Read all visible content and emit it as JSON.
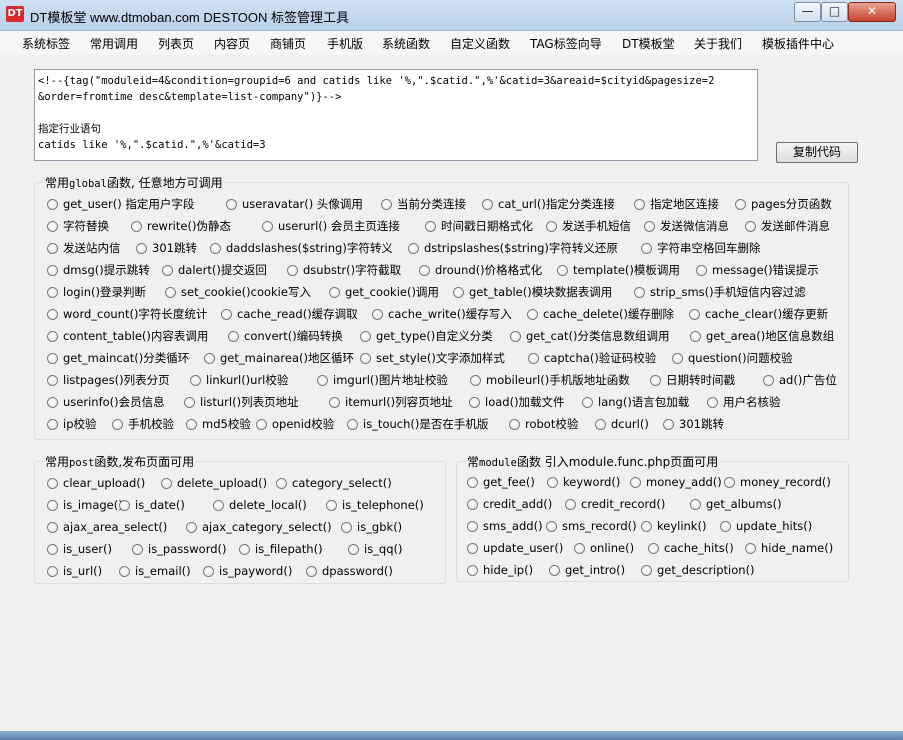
{
  "window": {
    "icon_text": "DT",
    "title": "DT模板堂 www.dtmoban.com DESTOON 标签管理工具",
    "minimize": "—",
    "maximize": "□",
    "close": "✕"
  },
  "menu": [
    "系统标签",
    "常用调用",
    "列表页",
    "内容页",
    "商铺页",
    "手机版",
    "系统函数",
    "自定义函数",
    "TAG标签向导",
    "DT模板堂",
    "关于我们",
    "模板插件中心"
  ],
  "code": {
    "lines": [
      "<!--{tag(\"moduleid=4&condition=groupid=6 and catids like '%,\".$catid.\",%'&catid=3&areaid=$cityid&pagesize=2",
      "&order=fromtime desc&template=list-company\")}-->",
      "",
      "指定行业语句",
      "catids like '%,\".$catid.\",%'&catid=3"
    ]
  },
  "copy_button": "复制代码",
  "global_group": {
    "title_prefix": "常用",
    "title_mono": "global",
    "title_suffix": "函数, 任意地方可调用",
    "rows": [
      [
        "get_user() 指定用户字段",
        "useravatar() 头像调用",
        "当前分类连接",
        "cat_url()指定分类连接",
        "指定地区连接",
        "pages分页函数"
      ],
      [
        "字符替换",
        "rewrite()伪静态",
        "userurl() 会员主页连接",
        "时间戳日期格式化",
        "发送手机短信",
        "发送微信消息",
        "发送邮件消息"
      ],
      [
        "发送站内信",
        "301跳转",
        "daddslashes($string)字符转义",
        "dstripslashes($string)字符转义还原",
        "字符串空格回车删除"
      ],
      [
        "dmsg()提示跳转",
        "dalert()提交返回",
        "dsubstr()字符截取",
        "dround()价格格式化",
        "template()模板调用",
        "message()错误提示"
      ],
      [
        "login()登录判断",
        "set_cookie()cookie写入",
        "get_cookie()调用",
        "get_table()模块数据表调用",
        "strip_sms()手机短信内容过滤"
      ],
      [
        "word_count()字符长度统计",
        "cache_read()缓存调取",
        "cache_write()缓存写入",
        "cache_delete()缓存删除",
        "cache_clear()缓存更新"
      ],
      [
        "content_table()内容表调用",
        "convert()编码转换",
        "get_type()自定义分类",
        "get_cat()分类信息数组调用",
        "get_area()地区信息数组"
      ],
      [
        "get_maincat()分类循环",
        "get_mainarea()地区循环",
        "set_style()文字添加样式",
        "captcha()验证码校验",
        "question()问题校验"
      ],
      [
        "listpages()列表分页",
        "linkurl()url校验",
        "imgurl()图片地址校验",
        "mobileurl()手机版地址函数",
        "日期转时间戳",
        "ad()广告位"
      ],
      [
        "userinfo()会员信息",
        "listurl()列表页地址",
        "itemurl()列容页地址",
        "load()加载文件",
        "lang()语言包加载",
        "用户名核验"
      ],
      [
        "ip校验",
        "手机校验",
        "md5校验",
        "openid校验",
        "is_touch()是否在手机版",
        "robot校验",
        "dcurl()",
        "301跳转"
      ]
    ]
  },
  "post_group": {
    "title_prefix": "常用",
    "title_mono": "post",
    "title_suffix": "函数,发布页面可用",
    "rows": [
      [
        "clear_upload()",
        "delete_upload()",
        "category_select()"
      ],
      [
        "is_image()",
        "is_date()",
        "delete_local()",
        "is_telephone()"
      ],
      [
        "ajax_area_select()",
        "ajax_category_select()",
        "is_gbk()"
      ],
      [
        "is_user()",
        "is_password()",
        "is_filepath()",
        "is_qq()"
      ],
      [
        "is_url()",
        "is_email()",
        "is_payword()",
        "dpassword()"
      ]
    ]
  },
  "module_group": {
    "title_prefix": "常",
    "title_mono": "module",
    "title_suffix": "函数 引入module.func.php页面可用",
    "rows": [
      [
        "get_fee()",
        "keyword()",
        "money_add()",
        "money_record()"
      ],
      [
        "credit_add()",
        "credit_record()",
        "get_albums()"
      ],
      [
        "sms_add()",
        "sms_record()",
        "keylink()",
        "update_hits()"
      ],
      [
        "update_user()",
        "online()",
        "cache_hits()",
        "hide_name()"
      ],
      [
        "hide_ip()",
        "get_intro()",
        "get_description()"
      ]
    ]
  }
}
